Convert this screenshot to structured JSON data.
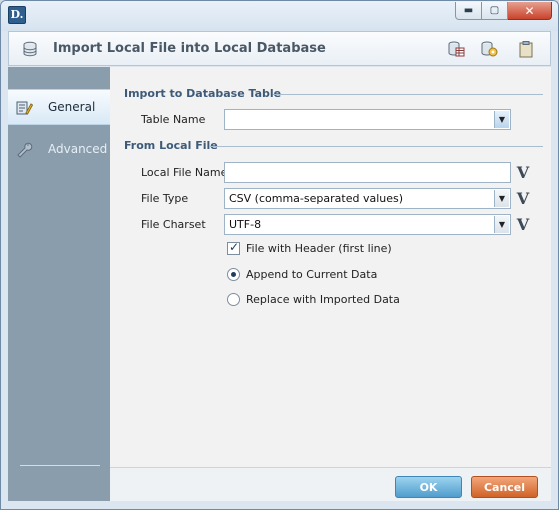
{
  "window": {
    "app_icon_text": "D.",
    "min_glyph": "▬",
    "max_glyph": "▢",
    "close_glyph": "✕"
  },
  "dialog": {
    "title": "Import Local File into Local Database",
    "header_icons": [
      "database-table-icon",
      "database-settings-icon",
      "clipboard-icon"
    ]
  },
  "sidebar": {
    "items": [
      {
        "label": "General",
        "icon": "general-config-icon",
        "active": true
      },
      {
        "label": "Advanced",
        "icon": "wrench-icon",
        "active": false
      }
    ]
  },
  "form": {
    "section_import": "Import to Database Table",
    "table_name_label": "Table Name",
    "table_name_value": "",
    "section_from": "From Local File",
    "local_file_label": "Local File Name",
    "local_file_value": "",
    "file_type_label": "File Type",
    "file_type_value": "CSV (comma-separated values)",
    "file_charset_label": "File Charset",
    "file_charset_value": "UTF-8",
    "variable_glyph": "V",
    "header_checkbox_label": "File with Header (first line)",
    "header_checkbox_checked": true,
    "radio_append_label": "Append to Current Data",
    "radio_replace_label": "Replace with Imported Data",
    "selected_radio": "append"
  },
  "footer": {
    "ok_label": "OK",
    "cancel_label": "Cancel"
  },
  "colors": {
    "accent": "#3d5a78",
    "ok_button": "#4f9dcd",
    "cancel_button": "#cf6328",
    "sidebar": "#8a9dad"
  }
}
